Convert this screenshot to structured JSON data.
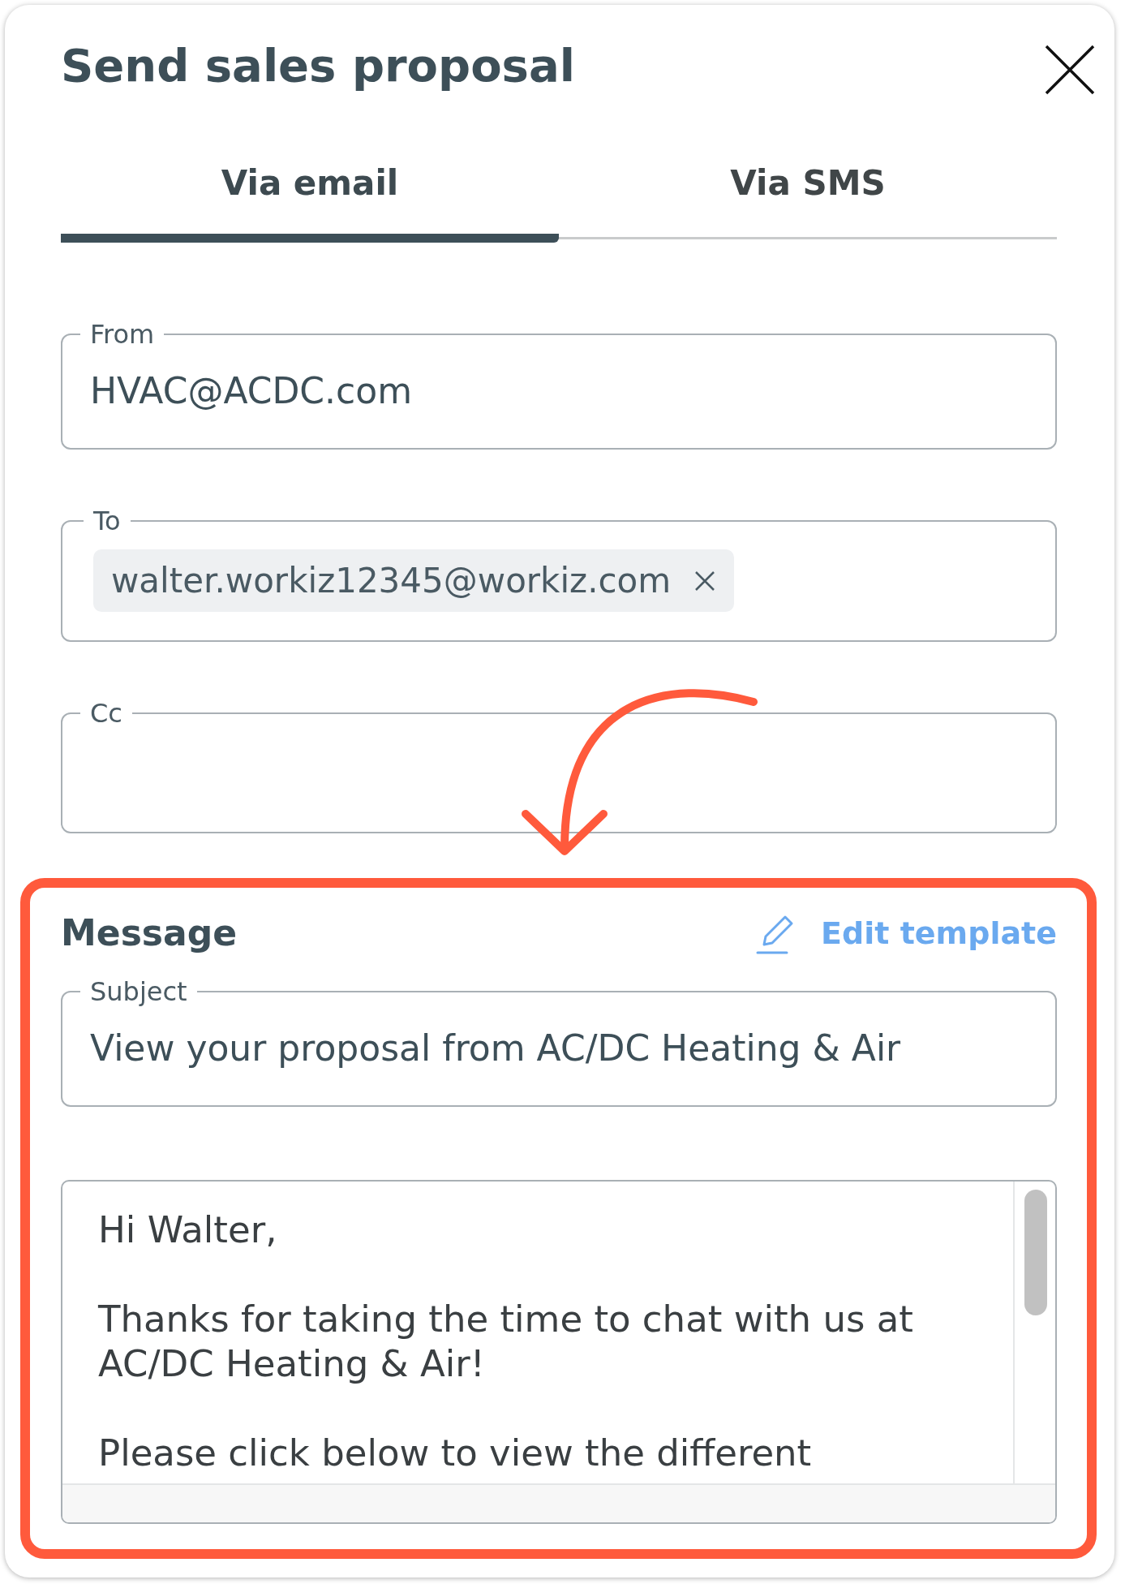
{
  "dialog": {
    "title": "Send sales proposal"
  },
  "tabs": [
    {
      "label": "Via email",
      "selected": true
    },
    {
      "label": "Via SMS",
      "selected": false
    }
  ],
  "fields": [
    {
      "kind": "text",
      "label": "From",
      "value": "HVAC@ACDC.com"
    },
    {
      "kind": "chips",
      "label": "To",
      "chips": [
        "walter.workiz12345@workiz.com"
      ]
    },
    {
      "kind": "text",
      "label": "Cc"
    }
  ],
  "message": {
    "heading": "Message",
    "edit_link": "Edit template",
    "subject": {
      "label": "Subject",
      "value": "View your proposal from AC/DC Heating & Air"
    },
    "body": [
      "Hi Walter,",
      "Thanks for taking the time to chat with us at\nAC/DC Heating & Air!",
      "Please click below to view the different"
    ]
  }
}
